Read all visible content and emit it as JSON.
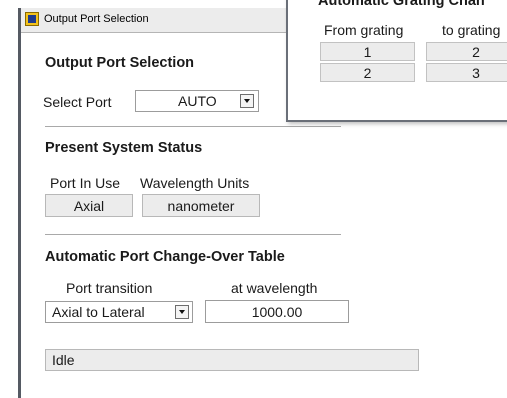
{
  "main_window": {
    "title": "Output Port Selection",
    "output_port_section": {
      "heading": "Output Port Selection",
      "select_port_label": "Select Port",
      "select_port_value": "AUTO"
    },
    "status_section": {
      "heading": "Present System Status",
      "port_in_use_label": "Port In Use",
      "port_in_use_value": "Axial",
      "wavelength_units_label": "Wavelength Units",
      "wavelength_units_value": "nanometer"
    },
    "changeover_section": {
      "heading": "Automatic Port Change-Over Table",
      "port_transition_label": "Port transition",
      "port_transition_value": "Axial to Lateral",
      "wavelength_label": "at wavelength",
      "wavelength_value": "1000.00"
    },
    "status_bar": "Idle"
  },
  "grating_window": {
    "title": "Automatic Grating Chan",
    "columns": [
      "From grating",
      "to grating"
    ],
    "rows": [
      [
        "1",
        "2"
      ],
      [
        "2",
        "3"
      ]
    ]
  },
  "colors": {
    "window_border": "#555a63",
    "field_gray": "#ececec",
    "titlebar": "#ececec",
    "app_icon": "#f3c21c"
  }
}
